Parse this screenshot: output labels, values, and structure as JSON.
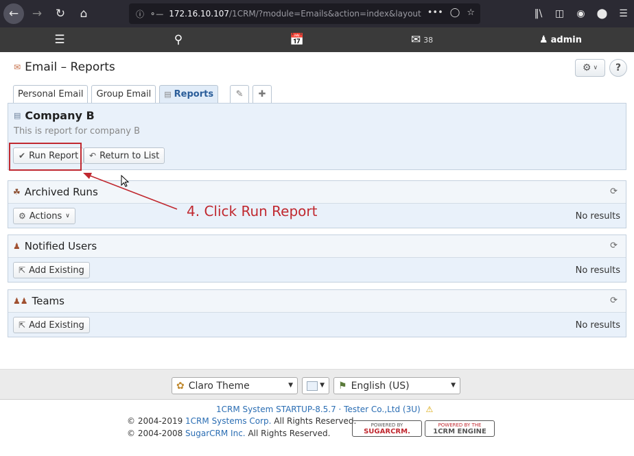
{
  "browser": {
    "url_host": "172.16.10.107",
    "url_path": "/1CRM/?module=Emails&action=index&layout",
    "icons": [
      "back-icon",
      "forward-icon",
      "reload-icon",
      "home-icon",
      "info-icon",
      "key-icon",
      "more-icon",
      "pocket-icon",
      "star-icon",
      "library-icon",
      "sidebar-icon",
      "account-icon",
      "extension-icon",
      "menu-icon"
    ]
  },
  "appnav": {
    "mail_count": "38",
    "user": "admin"
  },
  "page": {
    "title": "Email – Reports"
  },
  "tabs": [
    {
      "label": "Personal Email"
    },
    {
      "label": "Group Email"
    },
    {
      "label": "Reports"
    }
  ],
  "report": {
    "name": "Company B",
    "description": "This is report for company B",
    "run_label": "Run Report",
    "return_label": "Return to List"
  },
  "subpanels": {
    "archived": {
      "title": "Archived Runs",
      "action_label": "Actions",
      "empty": "No results"
    },
    "notified": {
      "title": "Notified Users",
      "action_label": "Add Existing",
      "empty": "No results"
    },
    "teams": {
      "title": "Teams",
      "action_label": "Add Existing",
      "empty": "No results"
    }
  },
  "annotation": "4. Click Run Report",
  "footer": {
    "theme": "Claro Theme",
    "language": "English (US)",
    "system_link": "1CRM System STARTUP-8.5.7 · Tester Co.,Ltd (3U)",
    "copy1_prefix": "© 2004-2019 ",
    "copy1_link": "1CRM Systems Corp.",
    "copy1_suffix": " All Rights Reserved.",
    "copy2_prefix": "© 2004-2008 ",
    "copy2_link": "SugarCRM Inc.",
    "copy2_suffix": " All Rights Reserved.",
    "badge1_top": "POWERED BY",
    "badge1_main": "SUGARCRM.",
    "badge2_top": "POWERED BY THE",
    "badge2_main": "1CRM ENGINE"
  },
  "colors": {
    "annotation": "#c0282f",
    "link": "#2a6db3",
    "active_tab": "#2a5d99"
  }
}
